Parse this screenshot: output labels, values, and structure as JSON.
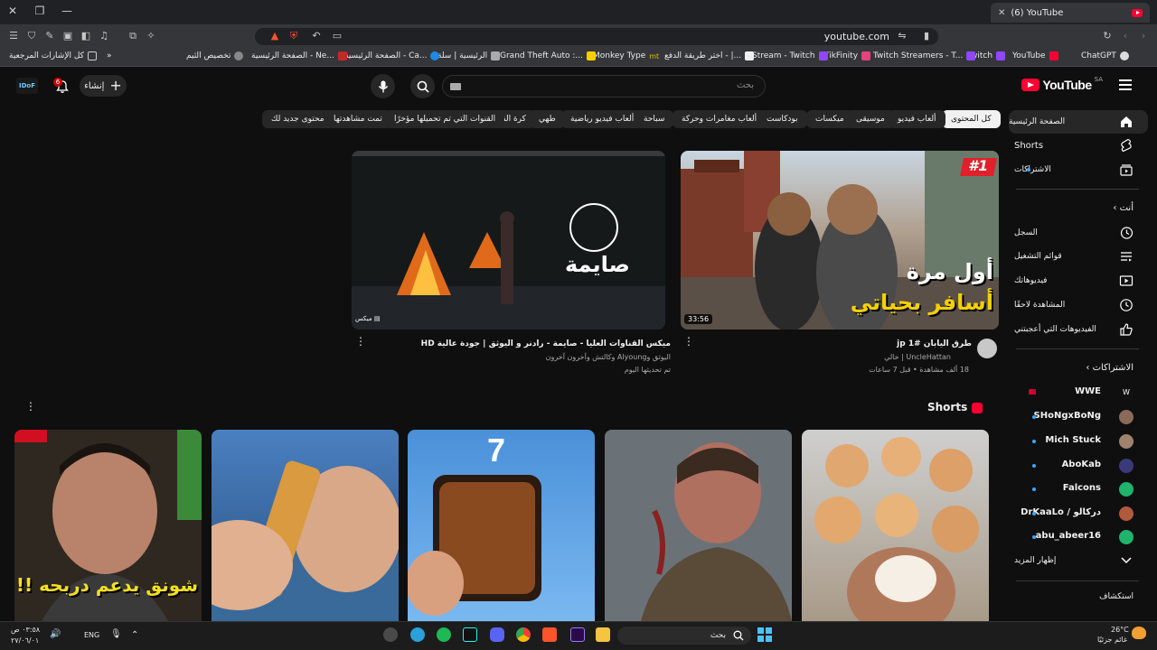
{
  "browser": {
    "tab_title": "(6) YouTube",
    "url": "youtube.com",
    "bookmarks": [
      "ChatGPT",
      "YouTube",
      "Twitch",
      "Twitch Streamers - T...",
      "TikFinity",
      "Stream - Twitch",
      "اختر طريقة الدفع - |...",
      "Monkey Type",
      "Grand Theft Auto :...",
      "الرئيسية | سلة",
      "الصفحة الرئيسية - Ca...",
      "الصفحة الرئيسية - Ne...",
      "تخصيص الثيم",
      "كل الإشارات المرجعية"
    ]
  },
  "header": {
    "logo": "YouTube",
    "logo_region": "SA",
    "search_placeholder": "بحث",
    "create_label": "إنشاء",
    "notifications_count": "6",
    "avatar_text": "IDoF"
  },
  "chips": [
    "كل المحتوى",
    "ألعاب فيديو",
    "موسيقى",
    "ميكسات",
    "بودكاست",
    "ألعاب مغامرات وحركة",
    "سباحة",
    "ألعاب فيديو رياضية",
    "طهي",
    "كرة القدم",
    "القنوات التي تم تحميلها مؤخرًا",
    "تمت مشاهدتها",
    "محتوى جديد لك"
  ],
  "sidebar": {
    "main": [
      {
        "label": "الصفحة الرئيسية",
        "icon": "home-icon"
      },
      {
        "label": "Shorts",
        "icon": "shorts-icon"
      },
      {
        "label": "الاشتراكات",
        "icon": "subscriptions-icon"
      }
    ],
    "you_heading": "أنت",
    "you": [
      {
        "label": "السجل",
        "icon": "history-icon"
      },
      {
        "label": "قوائم التشغيل",
        "icon": "playlists-icon"
      },
      {
        "label": "فيديوهاتك",
        "icon": "your-videos-icon"
      },
      {
        "label": "المشاهدة لاحقًا",
        "icon": "watch-later-icon"
      },
      {
        "label": "الفيديوهات التي أعجبتني",
        "icon": "liked-icon"
      }
    ],
    "subs_heading": "الاشتراكات",
    "subscriptions": [
      "WWE",
      "SHoNgxBoNg",
      "Mich Stuck",
      "AboKab",
      "Falcons",
      "DrKaaLo / دركالو",
      "abu_abeer16"
    ],
    "show_more": "إظهار المزيد",
    "explore_heading": "استكشاف"
  },
  "videos": [
    {
      "title": "طرق اليابان #1 jp",
      "channel": "UncleHattan | خالي",
      "meta": "18 ألف مشاهدة • قبل 7 ساعات",
      "duration": "33:56",
      "overlay_top": "#1",
      "overlay_line1": "أول مرة",
      "overlay_line2": "أسافر بحياتي"
    },
    {
      "title": "ميكس القناوات العليا - صايمة - رادنر و اليوثق | جودة عالية HD",
      "channel": "اليوثق وAlyoung وكالتش وآخرون آخرون",
      "meta": "تم تحديثها اليوم",
      "badge": "ميكس",
      "overlay": "صايمة"
    }
  ],
  "shorts": {
    "heading": "Shorts",
    "items": [
      {
        "overlay": ""
      },
      {
        "overlay": ""
      },
      {
        "overlay": "7"
      },
      {
        "overlay": ""
      },
      {
        "overlay": "شونق يدعم دربحه !!"
      }
    ]
  },
  "taskbar": {
    "search_placeholder": "بحث",
    "language": "ENG",
    "time": "٠٣:٥٨ ص",
    "date": "٢٧/٠٦/٠١",
    "weather_temp": "26°C",
    "weather_desc": "غائم جزئيًا"
  },
  "colors": {
    "background": "#0f0f0f",
    "chip": "#272727",
    "accent": "#ff0033",
    "unread_dot": "#3ea6ff"
  }
}
